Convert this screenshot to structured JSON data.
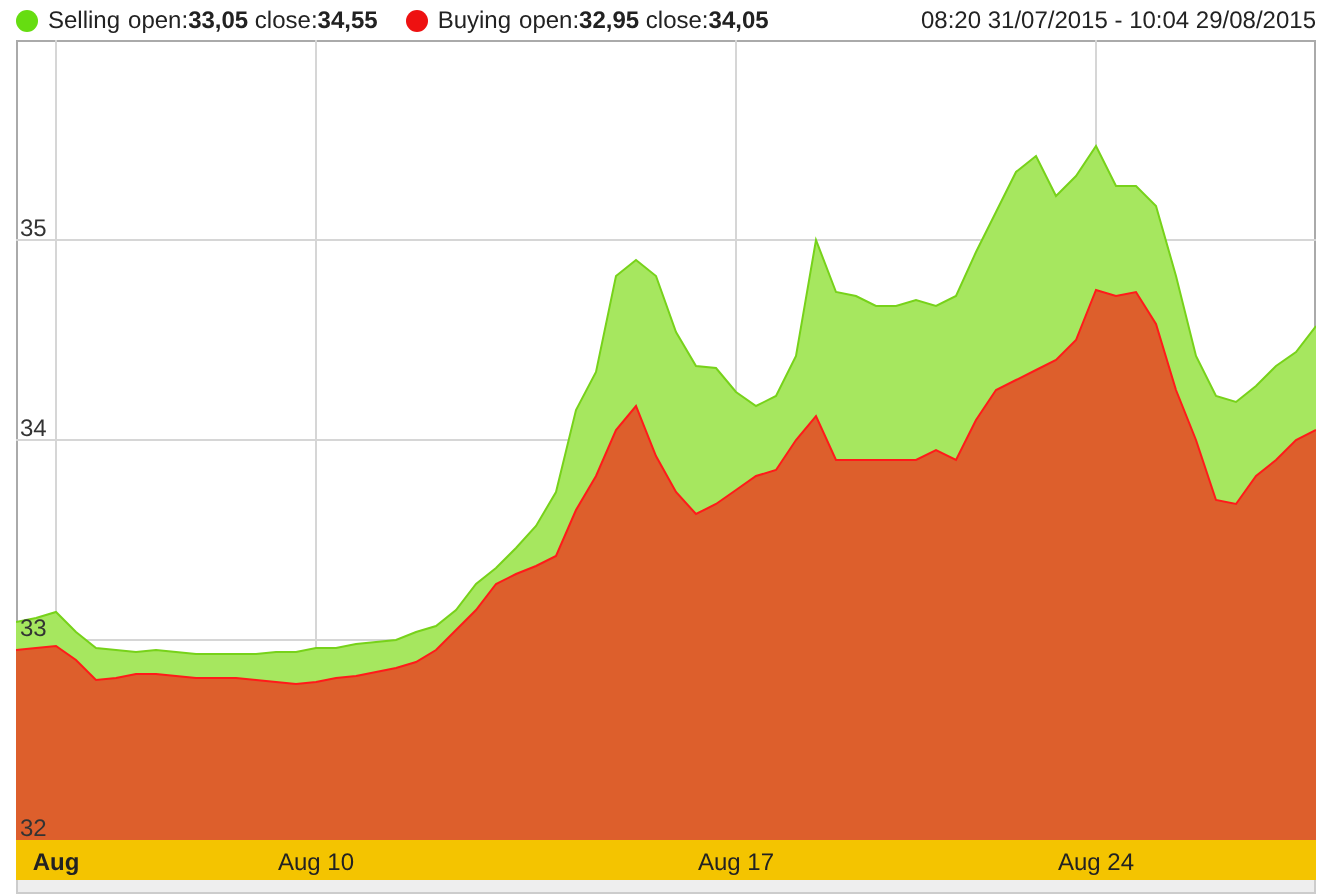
{
  "legend": [
    {
      "label": "open:**33,05** close:**34,55**",
      "color": "#66dd11"
    },
    {
      "label": "open:**32,95** close:**34,05**",
      "color": "#ee1111"
    }
  ],
  "date_range": "08:20 31/07/2015 - 10:04 29/08/2015",
  "chart_data": {
    "type": "area",
    "categories": [
      null,
      null,
      "Aug",
      null,
      null,
      null,
      null,
      null,
      null,
      null,
      null,
      null,
      null,
      null,
      null,
      "Aug 10",
      null,
      null,
      null,
      null,
      null,
      null,
      null,
      null,
      null,
      null,
      null,
      null,
      null,
      null,
      null,
      null,
      null,
      null,
      null,
      null,
      "Aug 17",
      null,
      null,
      null,
      null,
      null,
      null,
      null,
      null,
      null,
      null,
      null,
      null,
      null,
      null,
      null,
      null,
      null,
      "Aug 24",
      null,
      null,
      null,
      null,
      null,
      null,
      null,
      null,
      null,
      null,
      null
    ],
    "ylim": [
      32,
      36
    ],
    "yticks": [
      32,
      33,
      34,
      35
    ],
    "grid": true,
    "series": [
      {
        "name": "Selling",
        "color": "#a6e75f",
        "values": [
          33.09,
          33.11,
          33.14,
          33.04,
          32.96,
          32.95,
          32.94,
          32.95,
          32.94,
          32.93,
          32.93,
          32.93,
          32.93,
          32.94,
          32.94,
          32.96,
          32.96,
          32.98,
          32.99,
          33.0,
          33.04,
          33.07,
          33.15,
          33.28,
          33.36,
          33.46,
          33.57,
          33.74,
          34.15,
          34.34,
          34.82,
          34.9,
          34.82,
          34.54,
          34.37,
          34.36,
          34.24,
          34.17,
          34.22,
          34.42,
          35.0,
          34.74,
          34.72,
          34.67,
          34.67,
          34.7,
          34.67,
          34.72,
          34.94,
          35.14,
          35.34,
          35.42,
          35.22,
          35.32,
          35.47,
          35.27,
          35.27,
          35.17,
          34.82,
          34.42,
          34.22,
          34.19,
          34.27,
          34.37,
          34.44,
          34.57
        ]
      },
      {
        "name": "Buying",
        "color": "#dd5f2c",
        "values": [
          32.95,
          32.96,
          32.97,
          32.9,
          32.8,
          32.81,
          32.83,
          32.83,
          32.82,
          32.81,
          32.81,
          32.81,
          32.8,
          32.79,
          32.78,
          32.79,
          32.81,
          32.82,
          32.84,
          32.86,
          32.89,
          32.95,
          33.05,
          33.15,
          33.28,
          33.33,
          33.37,
          33.42,
          33.65,
          33.82,
          34.05,
          34.17,
          33.92,
          33.74,
          33.63,
          33.68,
          33.75,
          33.82,
          33.85,
          34.0,
          34.12,
          33.9,
          33.9,
          33.9,
          33.9,
          33.9,
          33.95,
          33.9,
          34.1,
          34.25,
          34.3,
          34.35,
          34.4,
          34.5,
          34.75,
          34.72,
          34.74,
          34.58,
          34.25,
          34.0,
          33.7,
          33.68,
          33.82,
          33.9,
          34.0,
          34.05
        ]
      }
    ]
  }
}
